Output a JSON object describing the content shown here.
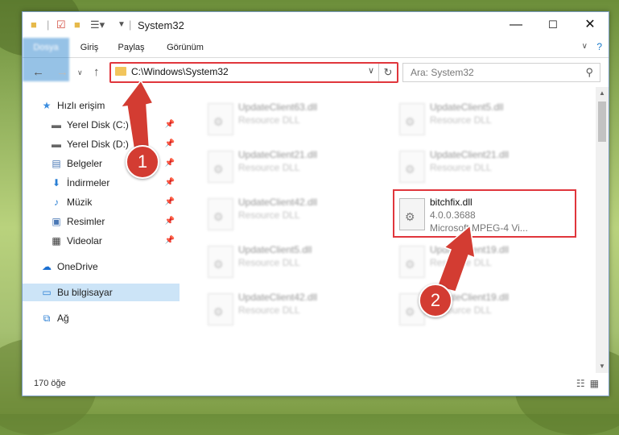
{
  "window": {
    "title": "System32"
  },
  "ribbon": {
    "tabs": [
      "Dosya",
      "Giriş",
      "Paylaş",
      "Görünüm"
    ]
  },
  "address": {
    "path": "C:\\Windows\\System32"
  },
  "search": {
    "placeholder": "Ara: System32"
  },
  "sidebar": {
    "items": [
      {
        "label": "Hızlı erişim",
        "icon": "star-icon"
      },
      {
        "label": "Yerel Disk (C:)",
        "icon": "drive-icon"
      },
      {
        "label": "Yerel Disk (D:)",
        "icon": "drive-icon"
      },
      {
        "label": "Belgeler",
        "icon": "documents-icon"
      },
      {
        "label": "İndirmeler",
        "icon": "download-icon"
      },
      {
        "label": "Müzik",
        "icon": "music-icon"
      },
      {
        "label": "Resimler",
        "icon": "pictures-icon"
      },
      {
        "label": "Videolar",
        "icon": "video-icon"
      },
      {
        "label": "OneDrive",
        "icon": "cloud-icon"
      },
      {
        "label": "Bu bilgisayar",
        "icon": "computer-icon"
      },
      {
        "label": "Ağ",
        "icon": "network-icon"
      }
    ]
  },
  "files": [
    {
      "name": "UpdateClient63.dll",
      "line1": "Resource DLL",
      "line2": ""
    },
    {
      "name": "UpdateClient5.dll",
      "line1": "Resource DLL",
      "line2": ""
    },
    {
      "name": "UpdateClient21.dll",
      "line1": "Resource DLL",
      "line2": ""
    },
    {
      "name": "UpdateClient21.dll",
      "line1": "Resource DLL",
      "line2": ""
    },
    {
      "name": "UpdateClient42.dll",
      "line1": "Resource DLL",
      "line2": ""
    },
    {
      "name": "bitchfix.dll",
      "line1": "4.0.0.3688",
      "line2": "Microsoft MPEG-4 Vi..."
    },
    {
      "name": "UpdateClient5.dll",
      "line1": "Resource DLL",
      "line2": ""
    },
    {
      "name": "UpdateClient19.dll",
      "line1": "Resource DLL",
      "line2": ""
    },
    {
      "name": "UpdateClient42.dll",
      "line1": "Resource DLL",
      "line2": ""
    },
    {
      "name": "UpdateClient19.dll",
      "line1": "Resource DLL",
      "line2": ""
    }
  ],
  "status": {
    "count": "170 öğe"
  },
  "annotations": {
    "badge1": "1",
    "badge2": "2",
    "color": "#d33c32"
  }
}
